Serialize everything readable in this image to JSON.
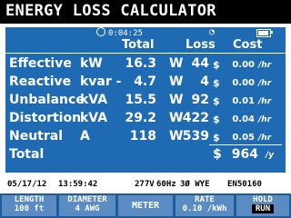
{
  "title": "ENERGY LOSS CALCULATOR",
  "status": {
    "timer": "0:04:25",
    "clock_icon": "clock-icon",
    "battery_icon": "battery-icon"
  },
  "headers": {
    "total": "Total",
    "loss": "Loss",
    "cost": "Cost"
  },
  "rows": [
    {
      "label": "Effective",
      "unit": "kW",
      "total": "16.3",
      "w": "W",
      "loss": "44",
      "dollar": "$",
      "cost": "0.00",
      "per": "/hr"
    },
    {
      "label": "Reactive",
      "unit": "kvar -",
      "total": "4.7",
      "w": "W",
      "loss": "4",
      "dollar": "$",
      "cost": "0.00",
      "per": "/hr"
    },
    {
      "label": "Unbalance",
      "unit": "kVA",
      "total": "15.5",
      "w": "W",
      "loss": "92",
      "dollar": "$",
      "cost": "0.01",
      "per": "/hr"
    },
    {
      "label": "Distortion",
      "unit": "kVA",
      "total": "29.2",
      "w": "W",
      "loss": "422",
      "dollar": "$",
      "cost": "0.04",
      "per": "/hr"
    },
    {
      "label": "Neutral",
      "unit": "A",
      "total": "118",
      "w": "W",
      "loss": "539",
      "dollar": "$",
      "cost": "0.05",
      "per": "/hr"
    }
  ],
  "total": {
    "label": "Total",
    "dollar": "$",
    "value": "964",
    "per": "/y"
  },
  "info": {
    "date": "05/17/12",
    "time": "13:59:42",
    "voltage": "277V",
    "frequency": "60Hz",
    "phase": "3Ø WYE",
    "standard": "EN50160"
  },
  "softkeys": {
    "length": {
      "line1": "LENGTH",
      "line2": "100 ft"
    },
    "diameter": {
      "line1": "DIAMETER",
      "line2": "4 AWG"
    },
    "meter": {
      "line1": "METER"
    },
    "rate": {
      "line1": "RATE",
      "line2": "0.10 /kWh"
    },
    "hold": {
      "line1": "HOLD",
      "line2": "RUN"
    }
  },
  "colors": {
    "panel": "#1f6bb3",
    "softkey_bar": "#1f5c9c",
    "softkey": "#5a8bc2",
    "titlebar": "#000000"
  }
}
